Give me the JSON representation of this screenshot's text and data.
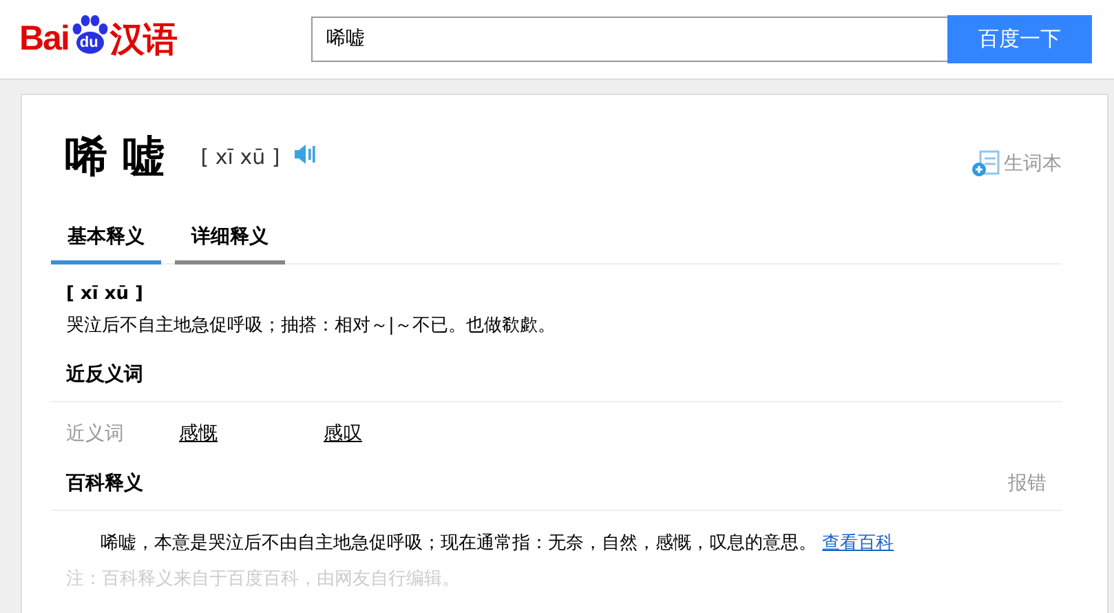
{
  "logo": {
    "left": "Bai",
    "badge": "du",
    "right": "汉语"
  },
  "search": {
    "value": "唏嘘",
    "button": "百度一下"
  },
  "entry": {
    "word": "唏 嘘",
    "pinyin": "[ xī xū ]",
    "wordbook": "生词本"
  },
  "tabs": [
    {
      "label": "基本释义",
      "selected": true
    },
    {
      "label": "详细释义",
      "selected": false
    }
  ],
  "basic": {
    "pinyin": "[ xī xū ]",
    "definition": "哭泣后不自主地急促呼吸；抽搭：相对～|～不已。也做欷歔。"
  },
  "synonyms": {
    "title": "近反义词",
    "label": "近义词",
    "words": [
      "感慨",
      "感叹"
    ]
  },
  "baike": {
    "title": "百科释义",
    "report": "报错",
    "text": "唏嘘，本意是哭泣后不由自主地急促呼吸；现在通常指：无奈，自然，感慨，叹息的意思。",
    "link": "查看百科",
    "note": "注：百科释义来自于百度百科，由网友自行编辑。"
  }
}
